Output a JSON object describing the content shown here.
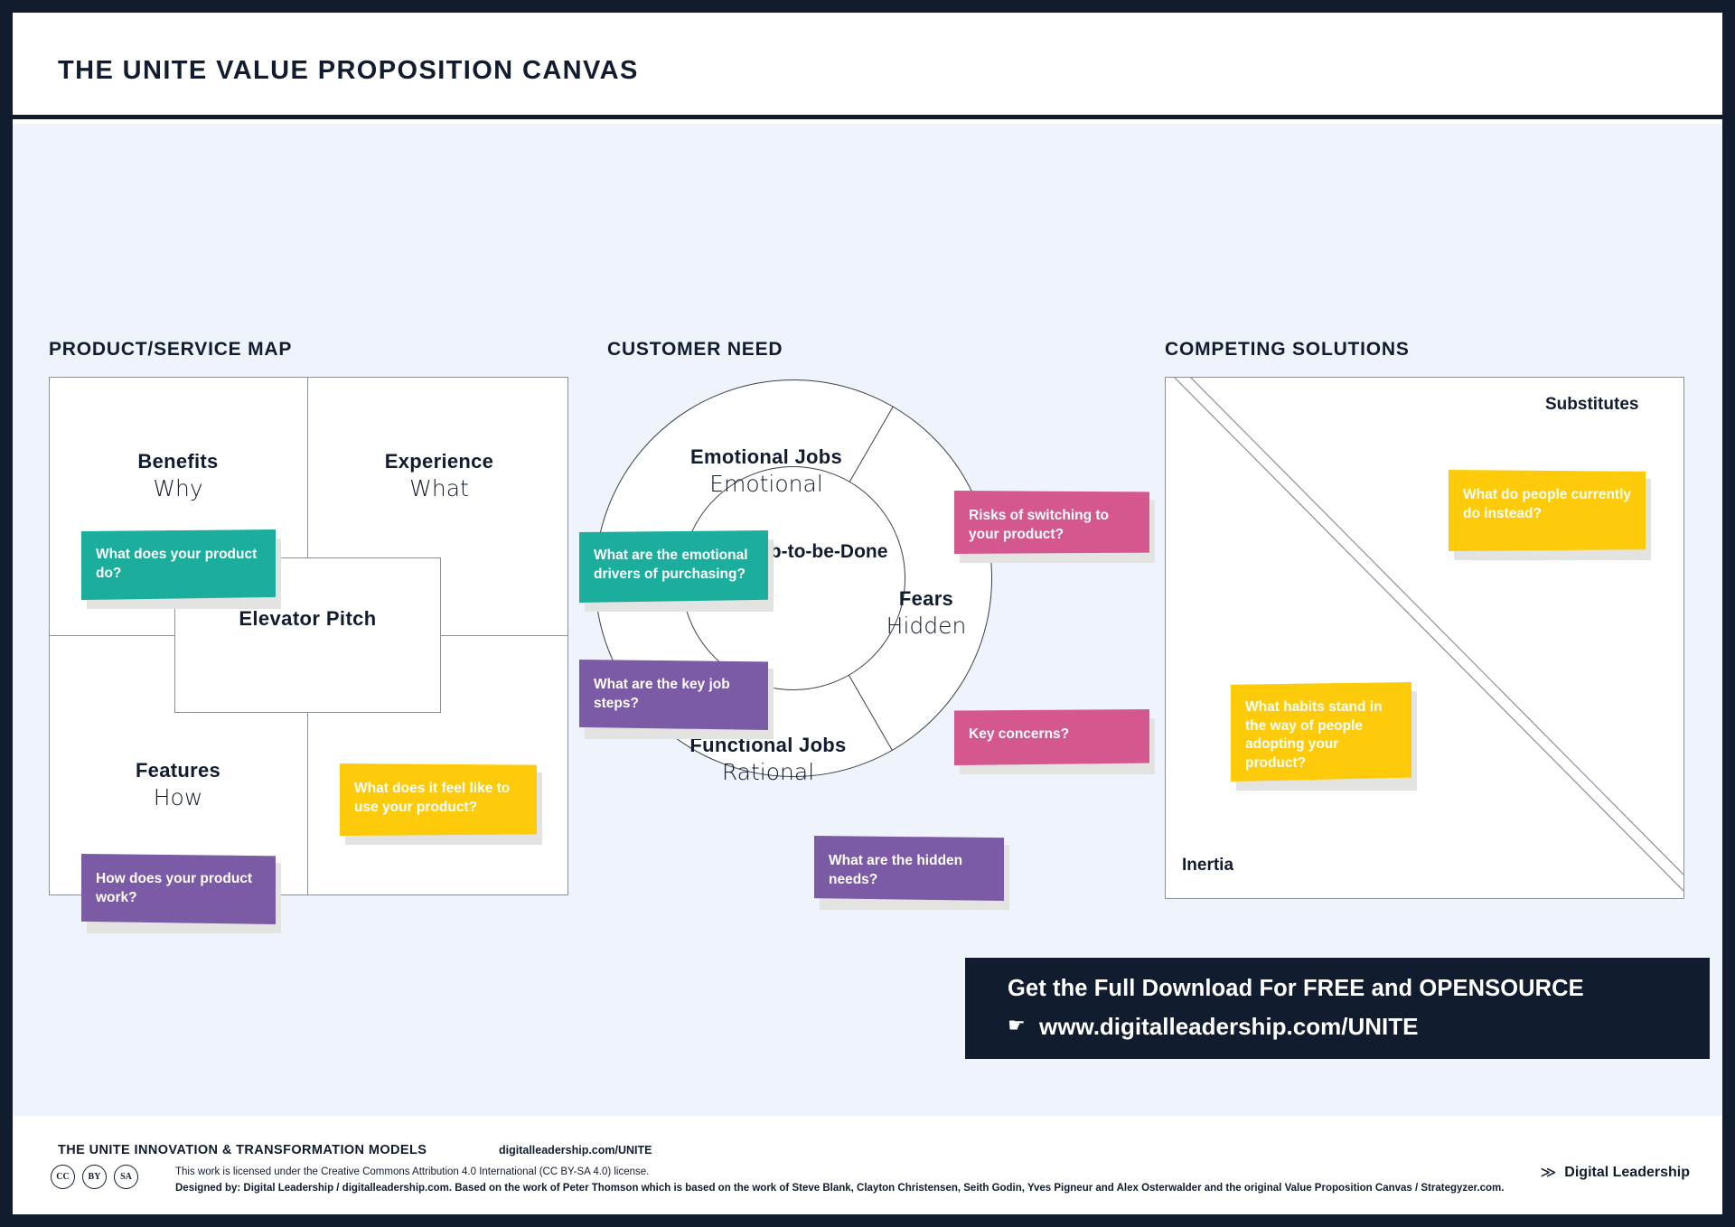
{
  "header": {
    "title": "THE UNITE VALUE PROPOSITION CANVAS"
  },
  "sections": {
    "product_service_map": {
      "heading": "PRODUCT/SERVICE MAP",
      "center_label": "Elevator Pitch",
      "quadrants": [
        {
          "title": "Benefits",
          "sub": "Why"
        },
        {
          "title": "Experience",
          "sub": "What"
        },
        {
          "title": "Features",
          "sub": "How"
        }
      ],
      "notes": [
        {
          "text": "What does your product do?",
          "color": "teal",
          "hex": "#1cae9c"
        },
        {
          "text": "How does your product work?",
          "color": "purple",
          "hex": "#7b5aa6"
        },
        {
          "text": "What does it feel like to use your product?",
          "color": "yellow",
          "hex": "#fdcb09"
        }
      ]
    },
    "customer_need": {
      "heading": "CUSTOMER NEED",
      "center_label": "Main Job-to-be-Done",
      "ring_labels": [
        {
          "title": "Emotional Jobs",
          "sub": "Emotional"
        },
        {
          "title": "Fears",
          "sub": "Hidden"
        },
        {
          "title": "Functional Jobs",
          "sub": "Rational"
        }
      ],
      "notes": [
        {
          "text": "What are the emotional drivers of purchasing?",
          "color": "teal",
          "hex": "#1cae9c"
        },
        {
          "text": "What are the key job steps?",
          "color": "purple",
          "hex": "#7b5aa6"
        },
        {
          "text": "Risks of switching to your product?",
          "color": "pink",
          "hex": "#d4588e"
        },
        {
          "text": "Key concerns?",
          "color": "pink",
          "hex": "#d4588e"
        },
        {
          "text": "What are the hidden needs?",
          "color": "purple",
          "hex": "#7b5aa6"
        }
      ]
    },
    "competing_solutions": {
      "heading": "COMPETING SOLUTIONS",
      "corner_top": "Substitutes",
      "corner_bottom": "Inertia",
      "notes": [
        {
          "text": "What do people currently do instead?",
          "color": "yellow",
          "hex": "#fdcb09"
        },
        {
          "text": "What habits stand in the way of people adopting your product?",
          "color": "yellow",
          "hex": "#fdcb09"
        }
      ]
    }
  },
  "cta": {
    "line1": "Get the Full Download For FREE and OPENSOURCE",
    "line2": "www.digitalleadership.com/UNITE",
    "hand_icon": "☛"
  },
  "footer": {
    "title": "THE UNITE INNOVATION & TRANSFORMATION MODELS",
    "url": "digitalleadership.com/UNITE",
    "license": "This work is licensed under the Creative Commons Attribution 4.0 International (CC BY-SA 4.0) license.",
    "credit": "Designed by: Digital Leadership / digitalleadership.com. Based on the work of Peter Thomson which is based on the work of Steve Blank, Clayton Christensen, Seith Godin, Yves Pigneur and Alex Osterwalder and the original Value Proposition Canvas / Strategyzer.com.",
    "cc_badges": [
      "CC",
      "BY",
      "SA"
    ],
    "brand_name": "Digital Leadership",
    "brand_mark": "≫"
  },
  "colors": {
    "frame": "#111c2e",
    "background": "#eff3fc",
    "teal": "#1cae9c",
    "purple": "#7b5aa6",
    "yellow": "#fdcb09",
    "pink": "#d4588e"
  }
}
